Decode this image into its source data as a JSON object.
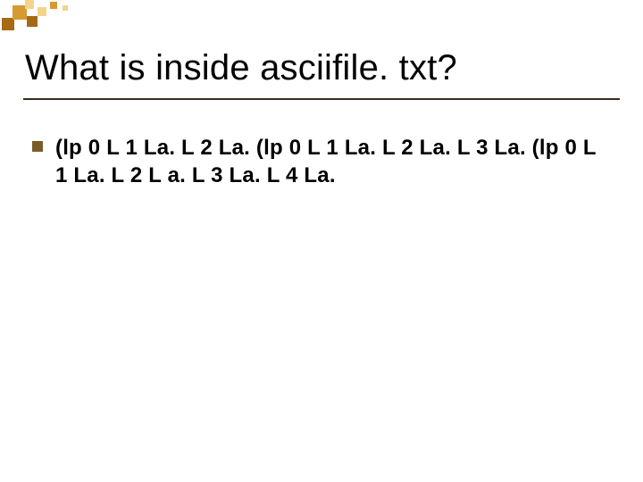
{
  "slide": {
    "title": "What is inside asciifile. txt?",
    "bullets": [
      "(lp 0 L 1 La. L 2 La. (lp 0 L 1 La. L 2 La. L 3 La. (lp 0 L 1 La. L 2 L a. L 3 La. L 4 La."
    ]
  },
  "theme": {
    "accent_dark": "#a66a14",
    "accent_mid": "#d79a32",
    "accent_light": "#f3d48a",
    "rule": "#3a2e18",
    "bullet": "#7a5c29"
  }
}
